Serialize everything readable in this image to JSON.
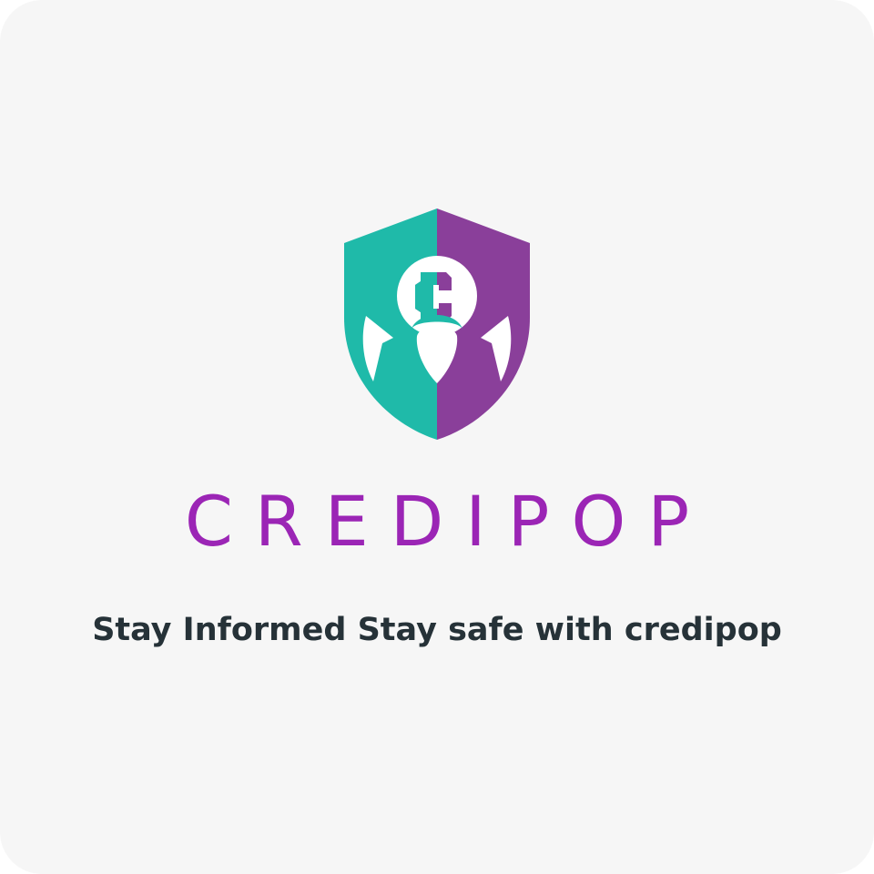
{
  "brand": {
    "name": "CREDIPOP",
    "tagline": "Stay Informed Stay safe with credipop",
    "logo_icon": "shield-guardian-logo-icon"
  },
  "colors": {
    "background": "#f6f6f6",
    "brand_text": "#9b25b5",
    "tagline_text": "#263238",
    "shield_left": "#1fbaa9",
    "shield_right": "#8a3f9a",
    "logo_accent": "#ffffff"
  }
}
